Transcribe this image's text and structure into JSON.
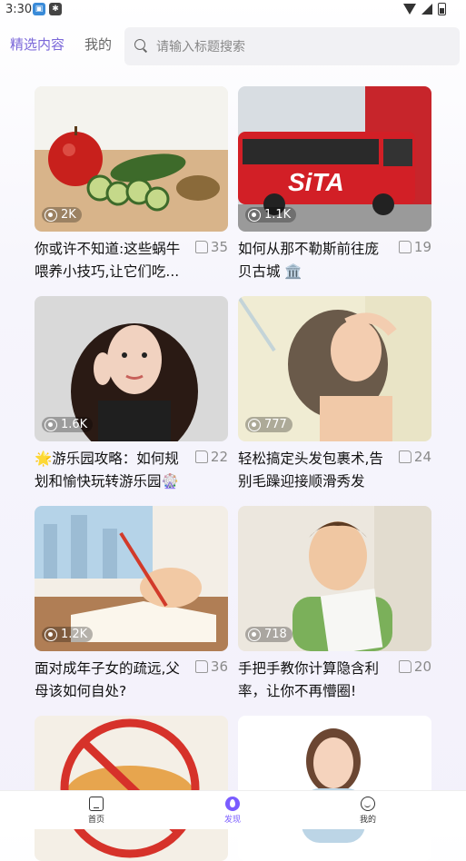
{
  "status": {
    "time": "3:30"
  },
  "tabs": [
    {
      "label": "精选内容",
      "active": true
    },
    {
      "label": "我的",
      "active": false
    }
  ],
  "search": {
    "placeholder": "请输入标题搜索"
  },
  "cards": [
    {
      "title": "你或许不知道:这些蜗牛喂养小技巧,让它们吃...",
      "views": "2K",
      "likes": "35",
      "image": "apple and cucumber slices on wooden board"
    },
    {
      "title": "如何从那不勒斯前往庞贝古城 🏛️",
      "views": "1.1K",
      "likes": "19",
      "image": "red SITA bus"
    },
    {
      "title": "🌟游乐园攻略：如何规划和愉快玩转游乐园🎡",
      "views": "1.6K",
      "likes": "22",
      "image": "woman with long dark hair"
    },
    {
      "title": "轻松搞定头发包裹术,告别毛躁迎接顺滑秀发",
      "views": "777",
      "likes": "24",
      "image": "woman washing hair in shower"
    },
    {
      "title": "面对成年子女的疏远,父母该如何自处?",
      "views": "1.2K",
      "likes": "36",
      "image": "hand writing in a book"
    },
    {
      "title": "手把手教你计算隐含利率，让你不再懵圈!",
      "views": "718",
      "likes": "20",
      "image": "man holding paper"
    },
    {
      "title": "",
      "views": "",
      "likes": "",
      "image": "pizza with prohibition sign"
    },
    {
      "title": "",
      "views": "",
      "likes": "",
      "image": "illustrated woman portrait"
    }
  ],
  "bottom_nav": [
    {
      "label": "首页",
      "icon": "home-icon",
      "active": false
    },
    {
      "label": "发现",
      "icon": "discover-icon",
      "active": true
    },
    {
      "label": "我的",
      "icon": "me-icon",
      "active": false
    }
  ],
  "colors": {
    "accent": "#7a67d9",
    "nav_active": "#7a5cff"
  }
}
